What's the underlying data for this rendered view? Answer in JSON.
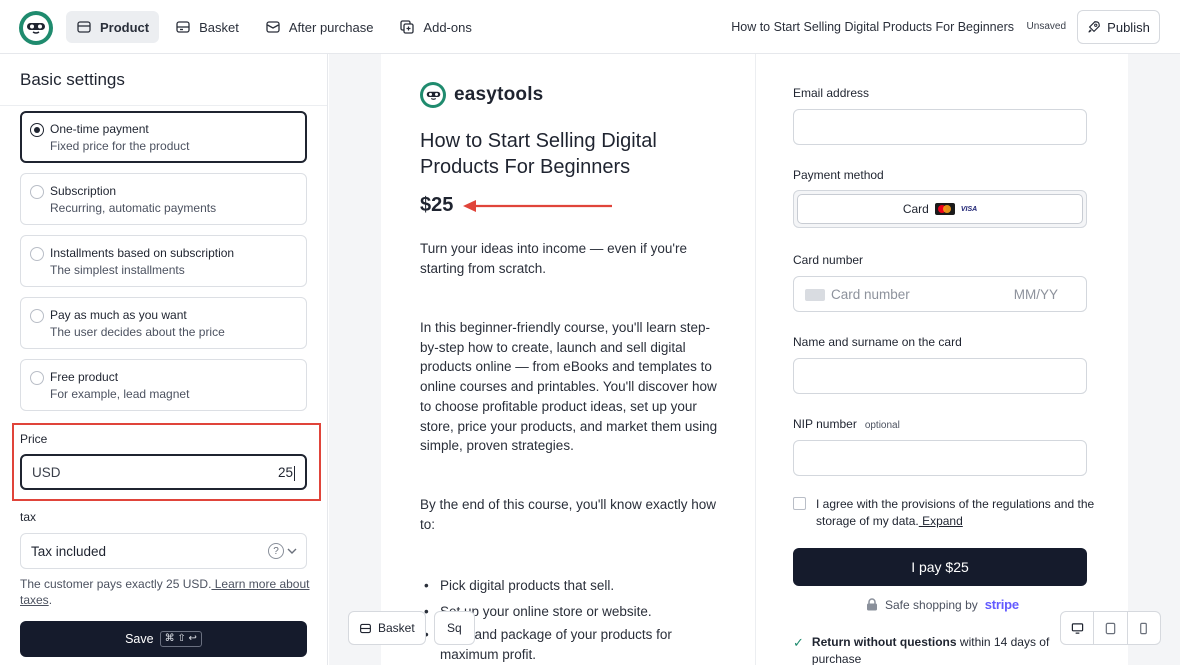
{
  "topbar": {
    "tabs": [
      {
        "label": "Product",
        "icon": "box-icon"
      },
      {
        "label": "Basket",
        "icon": "basket-icon"
      },
      {
        "label": "After purchase",
        "icon": "mail-icon"
      },
      {
        "label": "Add-ons",
        "icon": "addons-icon"
      }
    ],
    "doc_title": "How to Start Selling Digital Products For Beginners",
    "status": "Unsaved",
    "publish_label": "Publish"
  },
  "left": {
    "title": "Basic settings",
    "options": [
      {
        "title": "One-time payment",
        "subtitle": "Fixed price for the product",
        "selected": true
      },
      {
        "title": "Subscription",
        "subtitle": "Recurring, automatic payments",
        "selected": false
      },
      {
        "title": "Installments based on subscription",
        "subtitle": "The simplest installments",
        "selected": false
      },
      {
        "title": "Pay as much as you want",
        "subtitle": "The user decides about the price",
        "selected": false
      },
      {
        "title": "Free product",
        "subtitle": "For example, lead magnet",
        "selected": false
      }
    ],
    "price_label": "Price",
    "currency": "USD",
    "price_value": "25",
    "tax_label": "tax",
    "tax_value": "Tax included",
    "tax_note": "The customer pays exactly 25 USD.",
    "tax_link": " Learn more about taxes",
    "tax_note_end": ".",
    "save_label": "Save",
    "save_shortcut": "⌘ ⇧ ↩"
  },
  "preview": {
    "brand": "easytools",
    "product_title": "How to Start Selling Digital Products For Beginners",
    "price": "$25",
    "para1": "Turn your ideas into income — even if you're starting from scratch.",
    "para2": "In this beginner-friendly course, you'll learn step-by-step how to create, launch and sell digital products online — from eBooks and templates to online courses and printables. You'll discover how to choose profitable product ideas, set up your store, price your products, and market them using simple, proven strategies.",
    "para3": "By the end of this course, you'll know exactly how to:",
    "bullets": [
      "Pick digital products that sell.",
      "Set up your online store or website.",
      "Price and package of your products for maximum profit."
    ],
    "float_basket": "Basket",
    "float_sq": "Sq"
  },
  "checkout": {
    "email_label": "Email address",
    "payment_label": "Payment method",
    "payment_option": "Card",
    "visa_text": "VISA",
    "card_number_label": "Card number",
    "card_number_placeholder": "Card number",
    "expiry_placeholder": "MM/YY",
    "name_label": "Name and surname on the card",
    "nip_label": "NIP number",
    "nip_optional": "optional",
    "agree_text": "I agree with the provisions of the regulations and the storage of my data.",
    "agree_link": " Expand",
    "pay_label": "I pay $25",
    "safe_text": "Safe shopping by",
    "safe_brand": "stripe",
    "return_bold": "Return without questions",
    "return_rest": " within 14 days of purchase"
  },
  "colors": {
    "accent_dark": "#151b2c",
    "brand_green": "#1f8b6e",
    "highlight_red": "#e0443a",
    "stripe": "#635bff"
  }
}
